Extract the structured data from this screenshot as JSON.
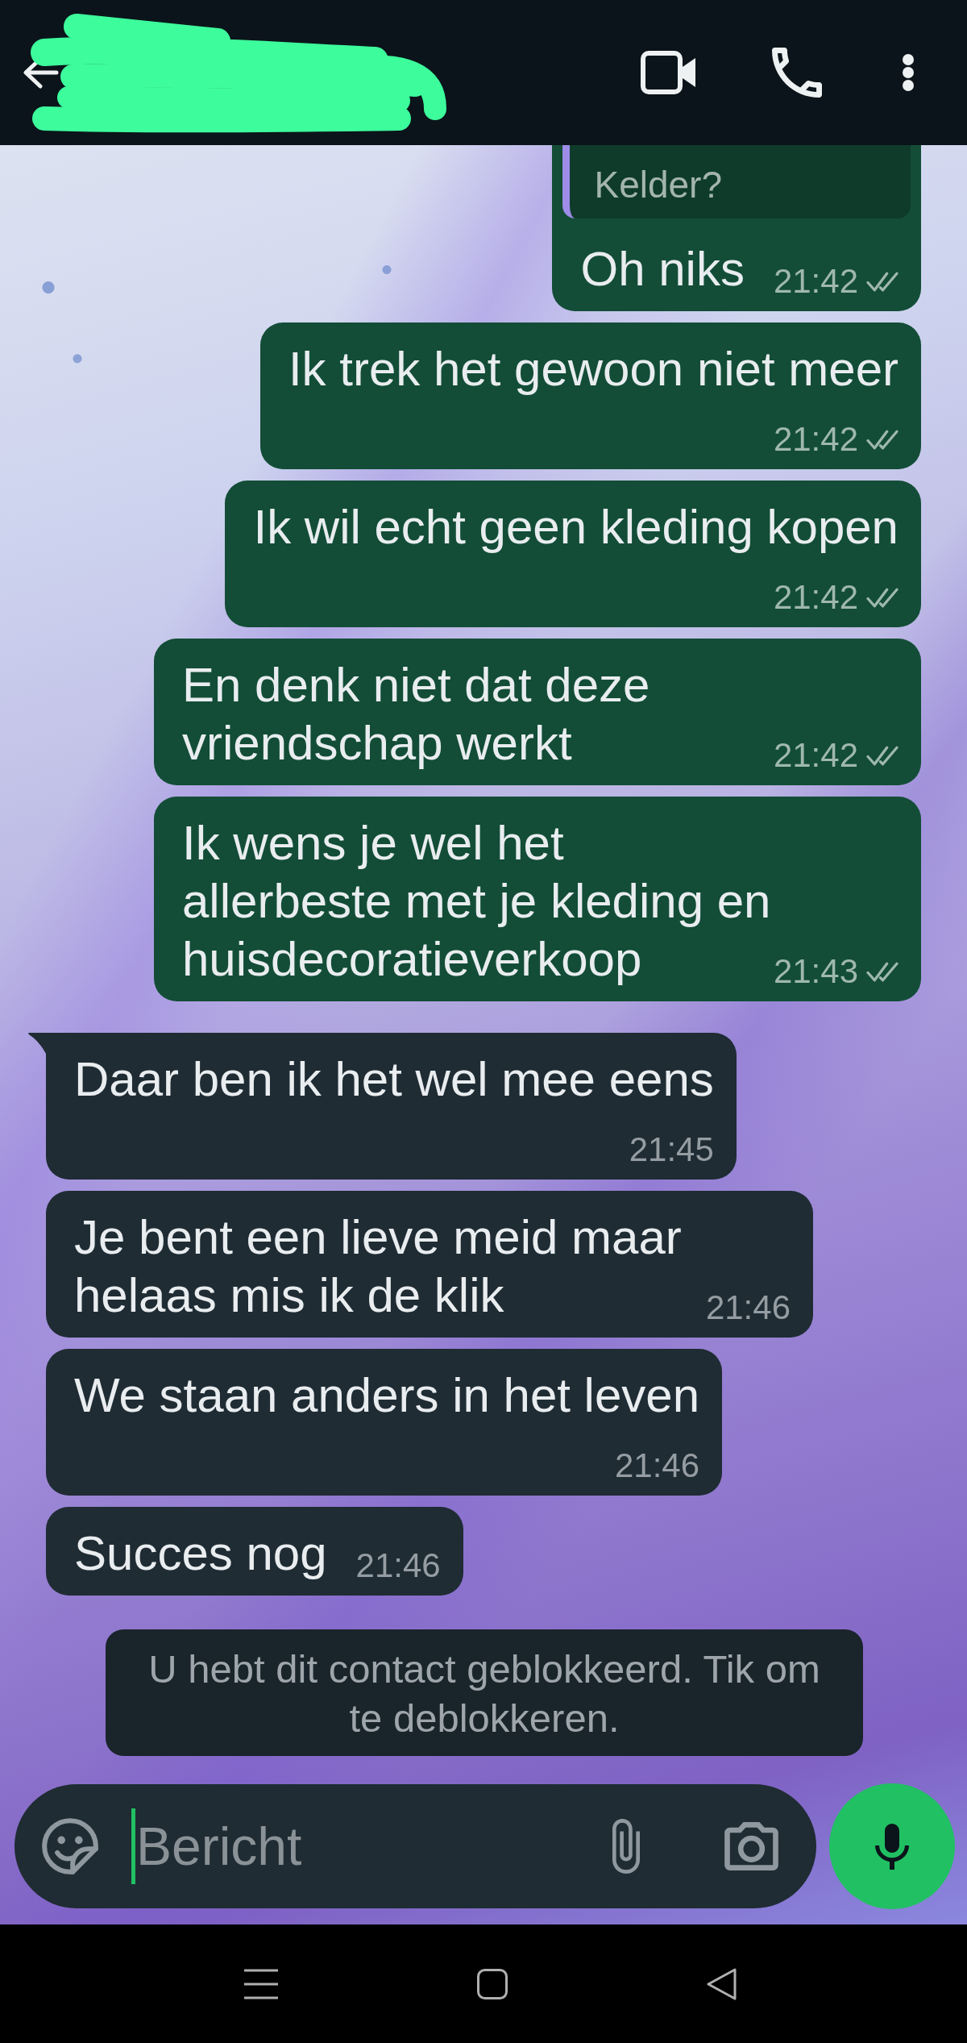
{
  "header": {
    "name_redacted": true
  },
  "messages": [
    {
      "kind": "outgoing",
      "tail": false,
      "quote": {
        "text": "Kelder?"
      },
      "text": "Oh niks",
      "time": "21:42",
      "delivered": true,
      "read": false
    },
    {
      "kind": "outgoing",
      "tail": false,
      "text": "Ik trek het gewoon niet meer",
      "time": "21:42",
      "delivered": true,
      "read": false
    },
    {
      "kind": "outgoing",
      "tail": false,
      "text": "Ik wil echt geen kleding kopen",
      "time": "21:42",
      "delivered": true,
      "read": false
    },
    {
      "kind": "outgoing",
      "tail": false,
      "text": "En denk niet dat deze\nvriendschap werkt",
      "time": "21:42",
      "delivered": true,
      "read": false
    },
    {
      "kind": "outgoing",
      "tail": false,
      "text": "Ik wens je wel het\nallerbeste met je kleding en\nhuisdecoratieverkoop",
      "time": "21:43",
      "delivered": true,
      "read": false
    },
    {
      "kind": "incoming",
      "tail": true,
      "text": "Daar ben ik het wel mee eens",
      "time": "21:45"
    },
    {
      "kind": "incoming",
      "tail": false,
      "text": "Je bent een lieve meid maar\nhelaas mis ik de klik",
      "time": "21:46"
    },
    {
      "kind": "incoming",
      "tail": false,
      "text": "We staan anders in het leven",
      "time": "21:46"
    },
    {
      "kind": "incoming",
      "tail": false,
      "text": "Succes nog",
      "time": "21:46"
    }
  ],
  "blocked_notice": {
    "text": "U hebt dit contact geblokkeerd. Tik om\nte deblokkeren."
  },
  "composer": {
    "placeholder": "Bericht",
    "focused": true
  }
}
